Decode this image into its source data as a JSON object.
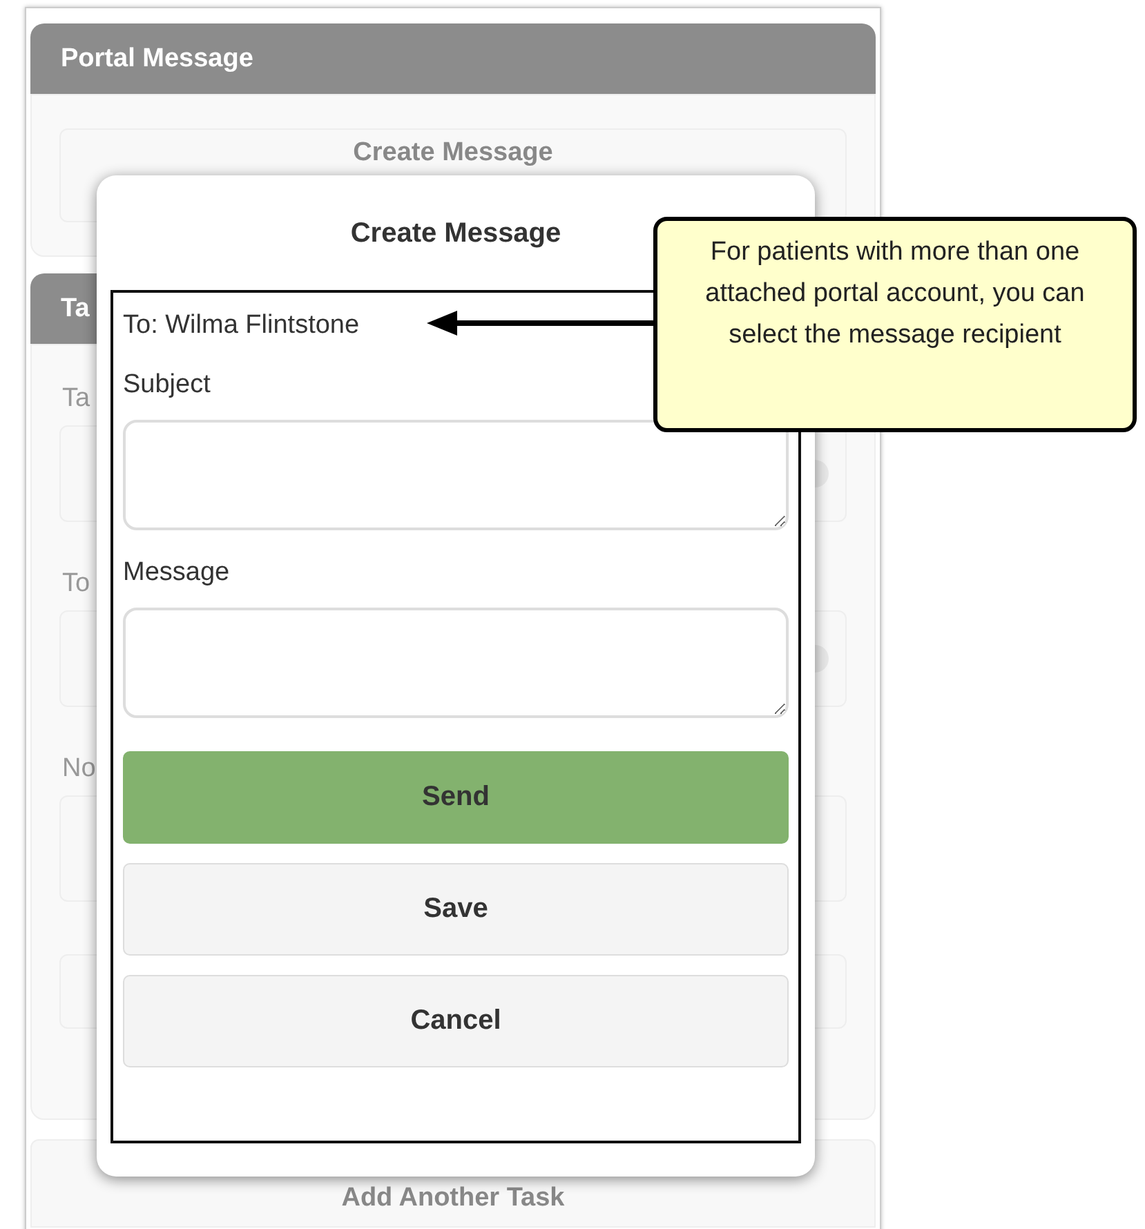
{
  "portal_message": {
    "title": "Portal Message",
    "create_button": "Create Message"
  },
  "task_panel": {
    "title": "Ta",
    "fields": [
      {
        "label": "Ta",
        "kind": "select"
      },
      {
        "label": "To",
        "kind": "select"
      },
      {
        "label": "No",
        "kind": "textarea"
      }
    ],
    "add_button": "Add Another Task"
  },
  "dialog": {
    "title": "Create Message",
    "recipient": "To: Wilma Flintstone",
    "fields": [
      {
        "label": "Subject"
      },
      {
        "label": "Message"
      }
    ],
    "buttons": [
      {
        "label": "Send",
        "kind": "primary"
      },
      {
        "label": "Save",
        "kind": "default"
      },
      {
        "label": "Cancel",
        "kind": "default"
      }
    ]
  },
  "callout": {
    "text": "For patients with more than one attached portal account, you can select the message recipient"
  }
}
